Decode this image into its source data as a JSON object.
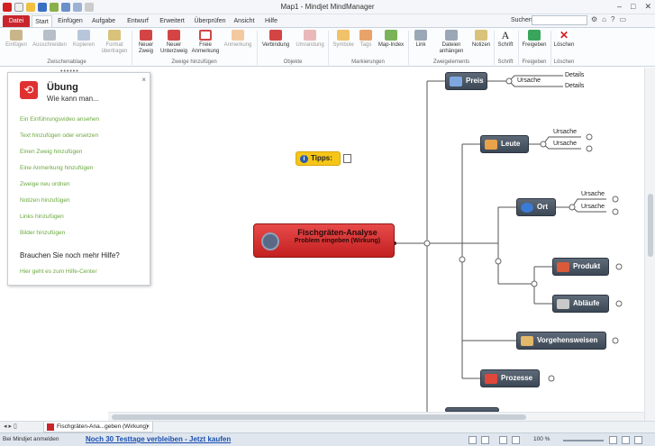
{
  "window": {
    "title": "Map1 - Mindjet MindManager"
  },
  "ribbon_tabs": [
    "Datei",
    "Start",
    "Einfügen",
    "Aufgabe",
    "Entwurf",
    "Erweitert",
    "Überprüfen",
    "Ansicht",
    "Hilfe"
  ],
  "search": {
    "label": "Suchen:",
    "placeholder": ""
  },
  "ribbon": {
    "buttons": {
      "einfuegen": "Einfügen",
      "ausschneiden": "Ausschneiden",
      "kopieren": "Kopieren",
      "format": "Format übertragen",
      "neuer_zweig": "Neuer Zweig",
      "neuer_unterzweig": "Neuer Unterzweig",
      "freie_anmerkung": "Freie Anmerkung",
      "anmerkung": "Anmerkung",
      "verbindung": "Verbindung",
      "umrandung": "Umrandung",
      "symbole": "Symbole",
      "tags": "Tags",
      "map_index": "Map-Index",
      "link": "Link",
      "dateien": "Dateien anhängen",
      "notizen": "Notizen",
      "schrift": "Schrift",
      "freigeben": "Freigeben",
      "loeschen": "Löschen"
    },
    "groups": {
      "zwischenablage": "Zwischenablage",
      "zweige": "Zweige hinzufügen",
      "objekte": "Objekte",
      "markierungen": "Markierungen",
      "zweigelemente": "Zweigelements",
      "schrift": "Schrift",
      "freigeben": "Freigeben",
      "loeschen": "Löschen"
    }
  },
  "task_panel": {
    "title": "Übung",
    "subtitle": "Wie kann man...",
    "links": [
      "Ein Einführungsvideo ansehen",
      "Text hinzufügen oder ersetzen",
      "Einen Zweig hinzufügen",
      "Eine Anmerkung hinzufügen",
      "Zweige neu ordnen",
      "Notizen hinzufügen",
      "Links hinzufügen",
      "Bilder hinzufügen"
    ],
    "help_title": "Brauchen Sie noch mehr Hilfe?",
    "help_link": "Hier geht es zum Hilfe-Center"
  },
  "tips_label": "Tipps:",
  "central_topic": {
    "title": "Fischgräten-Analyse",
    "subtitle": "Problem eingeben (Wirkung)"
  },
  "topics": {
    "preis": "Preis",
    "leute": "Leute",
    "ort": "Ort",
    "produkt": "Produkt",
    "ablaeufe": "Abläufe",
    "vorgehensweisen": "Vorgehensweisen",
    "prozesse": "Prozesse"
  },
  "subtopics": {
    "ursache": "Ursache",
    "details": "Details"
  },
  "doc_tab": {
    "label": "Fischgräten-Ana...geben (Wirkung)"
  },
  "status": {
    "login": "Bei Mindjet anmelden",
    "trial": "Noch 30 Testtage verbleiben - Jetzt kaufen",
    "zoom": "100 %"
  },
  "colors": {
    "accent": "#c8252c",
    "topic_bg": "#4a5563",
    "link_green": "#6aa83d",
    "tips": "#f5c518"
  }
}
